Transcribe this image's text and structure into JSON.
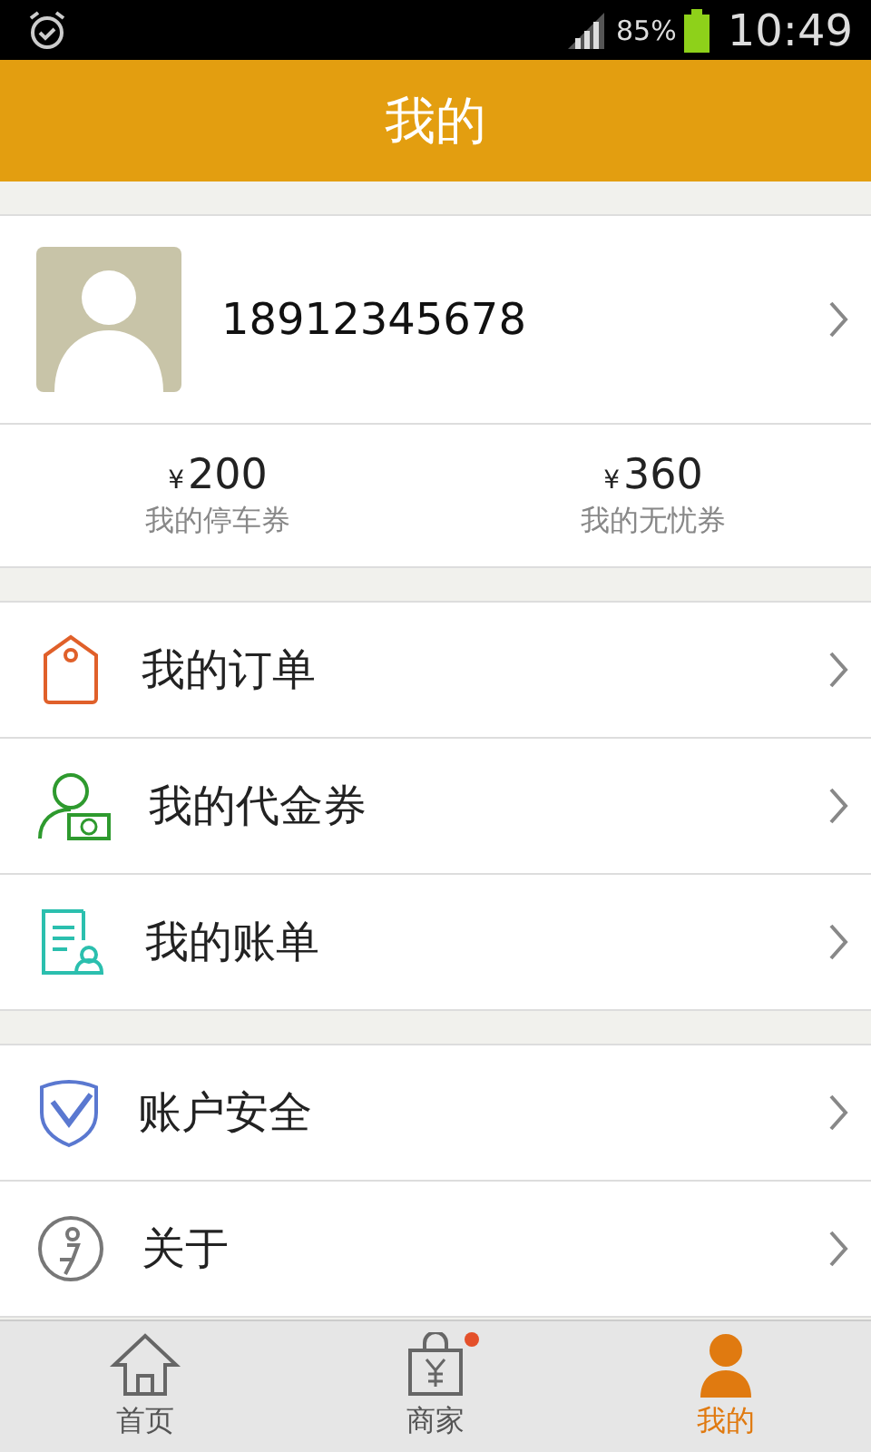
{
  "status_bar": {
    "battery": "85%",
    "time": "10:49"
  },
  "header": {
    "title": "我的"
  },
  "profile": {
    "phone": "18912345678"
  },
  "coupons": [
    {
      "currency": "¥",
      "amount": "200",
      "label": "我的停车券"
    },
    {
      "currency": "¥",
      "amount": "360",
      "label": "我的无忧券"
    }
  ],
  "menu_groups": [
    [
      {
        "kind": "tag",
        "label": "我的订单"
      },
      {
        "kind": "voucher",
        "label": "我的代金券"
      },
      {
        "kind": "bill",
        "label": "我的账单"
      }
    ],
    [
      {
        "kind": "shield",
        "label": "账户安全"
      },
      {
        "kind": "about",
        "label": "关于"
      }
    ]
  ],
  "tab_bar": [
    {
      "kind": "home",
      "label": "首页",
      "selected": false,
      "badge": false
    },
    {
      "kind": "shop",
      "label": "商家",
      "selected": false,
      "badge": true
    },
    {
      "kind": "me",
      "label": "我的",
      "selected": true,
      "badge": false
    }
  ]
}
